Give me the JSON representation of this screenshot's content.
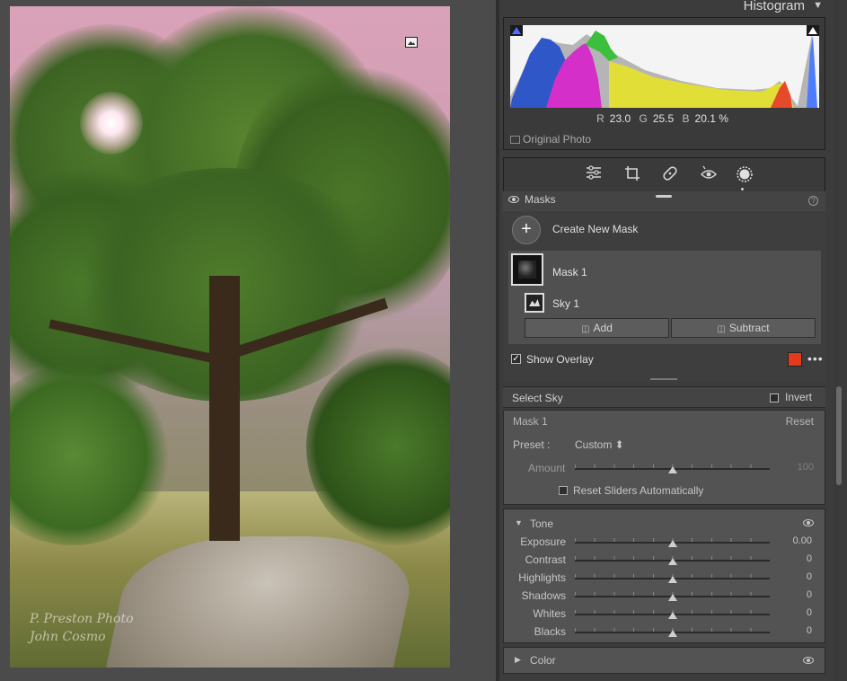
{
  "photo": {
    "watermark_line1": "P. Preston Photo",
    "watermark_line2": "John Cosmo"
  },
  "histogram": {
    "title": "Histogram",
    "r_label": "R",
    "r_value": "23.0",
    "g_label": "G",
    "g_value": "25.5",
    "b_label": "B",
    "b_value": "20.1 %",
    "original_photo_label": "Original Photo"
  },
  "tools": [
    "sliders-icon",
    "crop-icon",
    "healing-icon",
    "red-eye-icon",
    "masking-icon"
  ],
  "masks": {
    "header_label": "Masks",
    "help_glyph": "?",
    "create_label": "Create New Mask",
    "mask1_label": "Mask 1",
    "sky1_label": "Sky 1",
    "add_label": "Add",
    "subtract_label": "Subtract",
    "show_overlay_label": "Show Overlay",
    "show_overlay_checked": true,
    "overlay_color": "#e43a1c"
  },
  "select_sky": {
    "label": "Select Sky",
    "invert_label": "Invert"
  },
  "mask_settings": {
    "name": "Mask 1",
    "reset_label": "Reset",
    "preset_label": "Preset :",
    "preset_value": "Custom ⬍",
    "amount_label": "Amount",
    "amount_value": "100",
    "amount_level": 0.5,
    "reset_sliders_label": "Reset Sliders Automatically"
  },
  "tone": {
    "label": "Tone",
    "rows": [
      {
        "label": "Exposure",
        "value": "0.00",
        "level": 0.5
      },
      {
        "label": "Contrast",
        "value": "0",
        "level": 0.5
      },
      {
        "label": "Highlights",
        "value": "0",
        "level": 0.5
      },
      {
        "label": "Shadows",
        "value": "0",
        "level": 0.5
      },
      {
        "label": "Whites",
        "value": "0",
        "level": 0.5
      },
      {
        "label": "Blacks",
        "value": "0",
        "level": 0.5
      }
    ]
  },
  "color_section": {
    "label": "Color"
  }
}
